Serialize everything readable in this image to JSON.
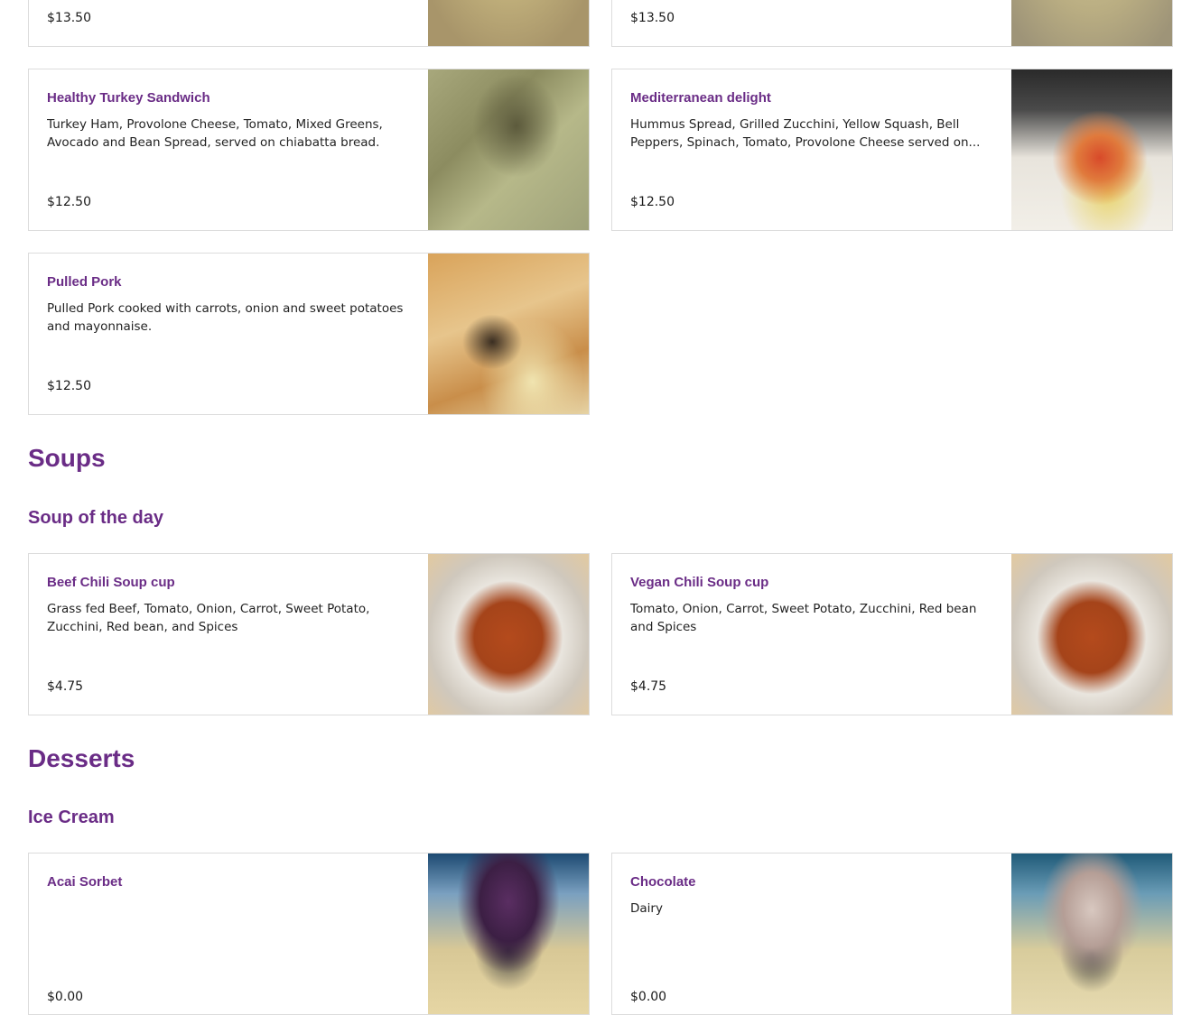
{
  "sections": {
    "soups": {
      "title": "Soups",
      "subtitle": "Soup of the day"
    },
    "desserts": {
      "title": "Desserts",
      "subtitle": "Ice Cream"
    }
  },
  "items": {
    "top_left": {
      "price": "$13.50"
    },
    "top_right": {
      "price": "$13.50"
    },
    "turkey": {
      "name": "Healthy Turkey Sandwich",
      "desc": "Turkey Ham, Provolone Cheese, Tomato, Mixed Greens, Avocado and Bean Spread, served on chiabatta bread.",
      "price": "$12.50"
    },
    "mediterranean": {
      "name": "Mediterranean delight",
      "desc": "Hummus Spread, Grilled Zucchini, Yellow Squash, Bell Peppers, Spinach, Tomato, Provolone Cheese served on...",
      "price": "$12.50"
    },
    "pulled_pork": {
      "name": "Pulled Pork",
      "desc": "Pulled Pork cooked with carrots, onion and sweet potatoes and mayonnaise.",
      "price": "$12.50"
    },
    "beef_chili": {
      "name": "Beef Chili Soup cup",
      "desc": "Grass fed Beef, Tomato, Onion, Carrot, Sweet Potato, Zucchini, Red bean, and Spices",
      "price": "$4.75"
    },
    "vegan_chili": {
      "name": "Vegan Chili Soup cup",
      "desc": "Tomato, Onion, Carrot, Sweet Potato, Zucchini, Red bean and Spices",
      "price": "$4.75"
    },
    "acai": {
      "name": "Acai Sorbet",
      "desc": "",
      "price": "$0.00"
    },
    "chocolate": {
      "name": "Chocolate",
      "desc": "Dairy",
      "price": "$0.00"
    }
  },
  "colors": {
    "accent": "#6a2c86",
    "border": "#dcdcdc",
    "text": "#1a1a1a"
  }
}
